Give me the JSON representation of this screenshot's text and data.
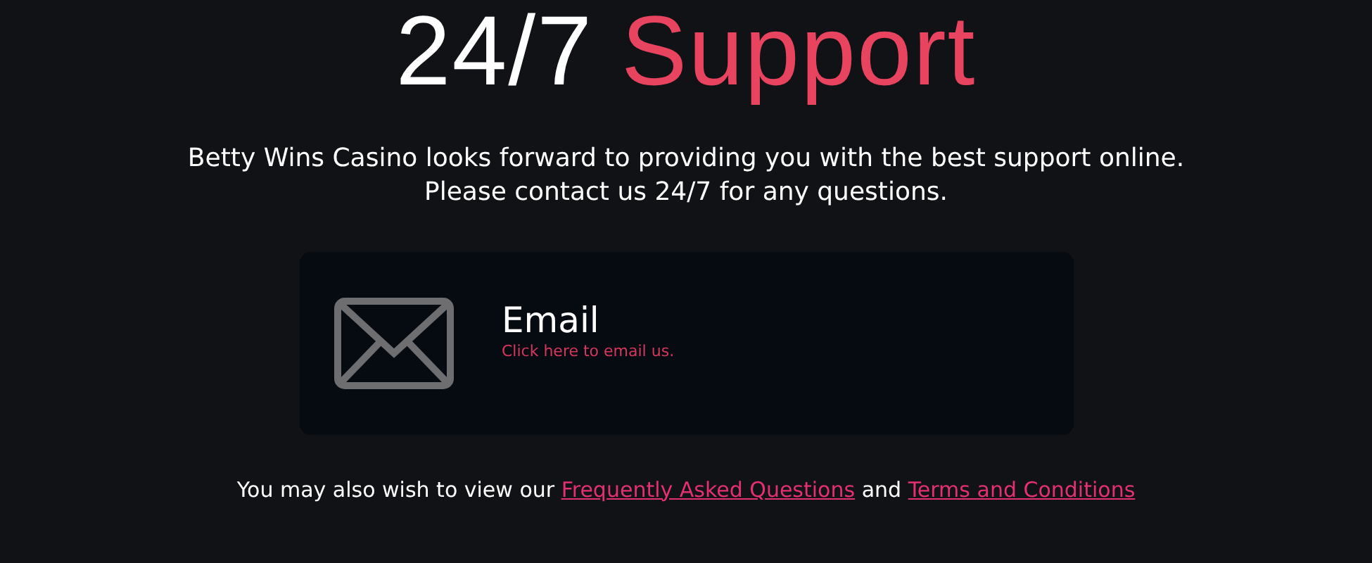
{
  "heading": {
    "lead": "24/7",
    "accent": "Support"
  },
  "intro": [
    "Betty Wins Casino looks forward to providing you with the best support online.",
    "Please contact us 24/7 for any questions."
  ],
  "contact": {
    "label": "Email",
    "link": "Click here to email us."
  },
  "footer": {
    "before": "You may also wish to view our",
    "links": [
      "Frequently Asked Questions",
      "Terms and Conditions"
    ],
    "joiner": "and"
  }
}
